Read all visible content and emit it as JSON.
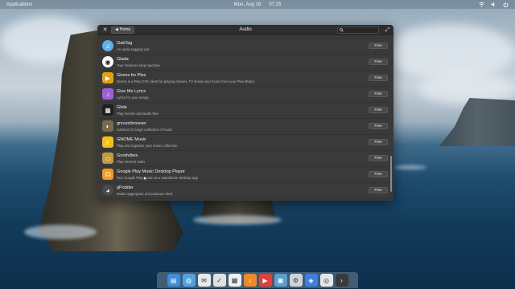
{
  "top_panel": {
    "applications_label": "Applications",
    "date": "Mon, Aug 18",
    "time": "07:25"
  },
  "window": {
    "home_label": "Home",
    "title": "Audio",
    "search_value": ""
  },
  "apps": [
    {
      "name": "GabTag",
      "description": "An audio tagging tool",
      "button": "Free",
      "icon": "gabtag-icon",
      "color": "#5bb3e8"
    },
    {
      "name": "Glada",
      "description": "Your hardcore loop machine",
      "button": "Free",
      "icon": "glada-icon",
      "color": "#ffffff"
    },
    {
      "name": "Girens for Plex",
      "description": "Girens is a Plex GTK client for playing movies, TV shows and music from your Plex library.",
      "button": "Free",
      "icon": "girens-icon",
      "color": "#e5a00d"
    },
    {
      "name": "Give Me Lyrics",
      "description": "Lyrics for your songs.",
      "button": "Free",
      "icon": "music-note-icon",
      "color": "#a25fd6"
    },
    {
      "name": "Glide",
      "description": "Play movies and audio files",
      "button": "Free",
      "icon": "film-icon",
      "color": "#1e1e1e"
    },
    {
      "name": "gmusicbrowser",
      "description": "Jukebox for large collection of music",
      "button": "Free",
      "icon": "gmusicbrowser-icon",
      "color": "#7a6a4a"
    },
    {
      "name": "GNOME Music",
      "description": "Play and organize your music collection",
      "button": "Free",
      "icon": "gnome-music-icon",
      "color": "#f5c211"
    },
    {
      "name": "Goodvibes",
      "description": "Play Internet radio",
      "button": "Free",
      "icon": "radio-icon",
      "color": "#c49a3a"
    },
    {
      "name": "Google Play Music Desktop Player",
      "description": "Run Google Play Music as a standalone desktop app",
      "button": "Free",
      "icon": "headphones-icon",
      "color": "#f49b1f"
    },
    {
      "name": "gPodder",
      "description": "Media aggregator and podcast client",
      "button": "Free",
      "icon": "gpodder-icon",
      "color": "#4a4a4a"
    }
  ],
  "dock": [
    {
      "name": "files-icon",
      "color": "#3d8ed8"
    },
    {
      "name": "browser-icon",
      "color": "#4fa3e0"
    },
    {
      "name": "mail-icon",
      "color": "#e9e9e9"
    },
    {
      "name": "tasks-icon",
      "color": "#e0e0e0"
    },
    {
      "name": "calendar-icon",
      "color": "#f0f0f0"
    },
    {
      "name": "music-icon",
      "color": "#f08a24"
    },
    {
      "name": "videos-icon",
      "color": "#e0413a"
    },
    {
      "name": "photos-icon",
      "color": "#5a9fd4"
    },
    {
      "name": "settings-icon",
      "color": "#d0d4d8"
    },
    {
      "name": "appcenter-icon",
      "color": "#3d7fe0"
    },
    {
      "name": "chrome-icon",
      "color": "#e8e8e8"
    },
    {
      "name": "terminal-icon",
      "color": "#3a3a3a"
    }
  ]
}
